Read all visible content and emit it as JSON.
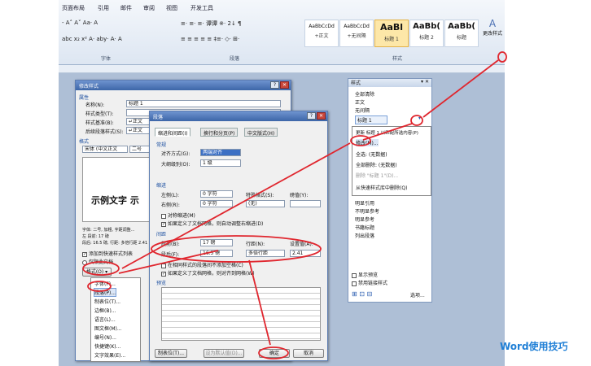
{
  "ribbon": {
    "tabs": [
      "页面布局",
      "引用",
      "邮件",
      "审阅",
      "视图",
      "开发工具"
    ],
    "groups": {
      "font": "字体",
      "paragraph": "段落",
      "styles": "样式"
    },
    "font_row1": "- A˄ A˅ Aa· A",
    "font_row2": "abc x₂ x² A· aby· A· A",
    "para_row1": "≡· ≡· ≡· 谭谭 ※· 2↓ ¶",
    "para_row2": "≡ ≡ ≡ ≡ ≡ ‡≡· ◇· ⊞·",
    "style_gallery": [
      {
        "sample": "AaBbCcDd",
        "name": "+正文"
      },
      {
        "sample": "AaBbCcDd",
        "name": "+无间隔"
      },
      {
        "sample": "AaBl",
        "name": "标题 1"
      },
      {
        "sample": "AaBb(",
        "name": "标题 2"
      },
      {
        "sample": "AaBb(",
        "name": "标题"
      }
    ],
    "change_styles": "更改样式"
  },
  "modify_style": {
    "title": "修改样式",
    "attributes": "属性",
    "name_label": "名称(N):",
    "name_value": "标题 1",
    "style_type_label": "样式类型(T):",
    "based_on_label": "样式基准(B):",
    "based_on_value": "↵正文",
    "next_label": "后续段落样式(S):",
    "next_value": "↵正文",
    "format_section": "格式",
    "font_value": "宋体 (中文正文",
    "size_value": "二号",
    "sample_text": "示例文字  示",
    "desc_lines": [
      "字体: 二号, 加粗, 字距调整...",
      "左 段前: 17 磅",
      "段后: 16.5 磅, 行距: 多倍行距 2.41 字行"
    ],
    "add_to_quick": "添加到快速样式列表",
    "only_this_doc": "仅限此文档",
    "format_button": "格式(O) ▾",
    "format_menu": [
      "字体(F)...",
      "段落(P)...",
      "制表位(T)...",
      "边框(B)...",
      "语言(L)...",
      "图文框(M)...",
      "编号(N)...",
      "快捷键(K)...",
      "文字效果(E)..."
    ]
  },
  "paragraph": {
    "title": "段落",
    "tabs": [
      "缩进和间距(I)",
      "换行和分页(P)",
      "中文版式(H)"
    ],
    "general": "常规",
    "align_label": "对齐方式(G):",
    "align_value": "两端对齐",
    "outline_label": "大纲级别(O):",
    "outline_value": "1 级",
    "indent": "缩进",
    "left_label": "左侧(L):",
    "left_value": "0 字符",
    "right_label": "右侧(R):",
    "right_value": "0 字符",
    "special_label": "特殊格式(S):",
    "special_value": "(无)",
    "by_label": "磅值(Y):",
    "mirror": "对称缩进(M)",
    "auto_adjust": "如果定义了文档网格，则自动调整右缩进(D)",
    "spacing": "间距",
    "before_label": "段前(B):",
    "before_value": "17 磅",
    "after_label": "段后(F):",
    "after_value": "16.5 磅",
    "line_label": "行距(N):",
    "line_value": "多倍行距",
    "at_label": "设置值(A):",
    "at_value": "2.41",
    "no_space_same": "在相同样式的段落间不添加空格(C)",
    "snap_grid": "如果定义了文档网格，则对齐到网格(W)",
    "preview": "预览",
    "tabs_button": "制表位(T)...",
    "default_button": "设为默认值(D)...",
    "ok_button": "确定",
    "cancel_button": "取消"
  },
  "styles_pane": {
    "title": "样式",
    "items": [
      "全部清除",
      "正文",
      "无间隔",
      "标题 1"
    ],
    "context_menu": [
      "更新 标题 1 以匹配所选内容(P)",
      "修改(M)...",
      "全选: (无数据)",
      "全部删除: (无数据)",
      "删除 \"标题 1\"(D)...",
      "从快速样式库中删除(Q)"
    ],
    "more_items": [
      "明显引用",
      "不明显参考",
      "明显参考",
      "书籍标题",
      "列出段落"
    ],
    "show_preview": "显示预览",
    "disable_linked": "禁用链接样式",
    "options": "选项..."
  },
  "watermark": "Word使用技巧"
}
